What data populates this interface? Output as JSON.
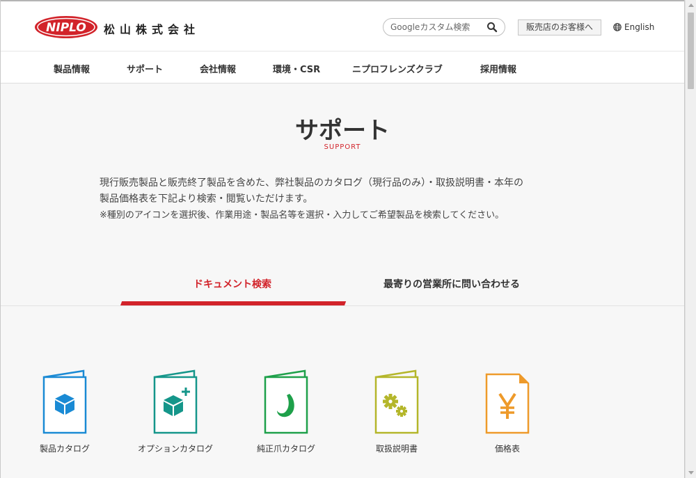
{
  "header": {
    "logo_text": "NIPLO",
    "company_name": "松山株式会社",
    "search": {
      "placeholder": "Googleカスタム検索",
      "icon": "search-icon"
    },
    "dealer_button": "販売店のお客様へ",
    "language": "English"
  },
  "nav": {
    "items": [
      {
        "label": "製品情報"
      },
      {
        "label": "サポート"
      },
      {
        "label": "会社情報"
      },
      {
        "label": "環境・CSR"
      },
      {
        "label": "ニプロフレンズクラブ"
      },
      {
        "label": "採用情報"
      }
    ]
  },
  "page": {
    "title": "サポート",
    "subtitle": "SUPPORT",
    "intro_line1": "現行販売製品と販売終了製品を含めた、弊社製品のカタログ（現行品のみ）・取扱説明書・本年の",
    "intro_line2": "製品価格表を下記より検索・閲覧いただけます。",
    "intro_note": "※種別のアイコンを選択後、作業用途・製品名等を選択・入力してご希望製品を検索してください。"
  },
  "tabs": [
    {
      "label": "ドキュメント検索",
      "active": true
    },
    {
      "label": "最寄りの営業所に問い合わせる",
      "active": false
    }
  ],
  "catalogs": [
    {
      "label": "製品カタログ",
      "icon": "cube-icon",
      "color": "#1a8ad4"
    },
    {
      "label": "オプションカタログ",
      "icon": "cube-plus-icon",
      "color": "#15968a"
    },
    {
      "label": "純正爪カタログ",
      "icon": "claw-icon",
      "color": "#1ea04a"
    },
    {
      "label": "取扱説明書",
      "icon": "gears-icon",
      "color": "#b4b62a"
    },
    {
      "label": "価格表",
      "icon": "yen-icon",
      "color": "#ee9a2a"
    }
  ],
  "colors": {
    "accent": "#d2232a",
    "background": "#f7f7f7"
  }
}
